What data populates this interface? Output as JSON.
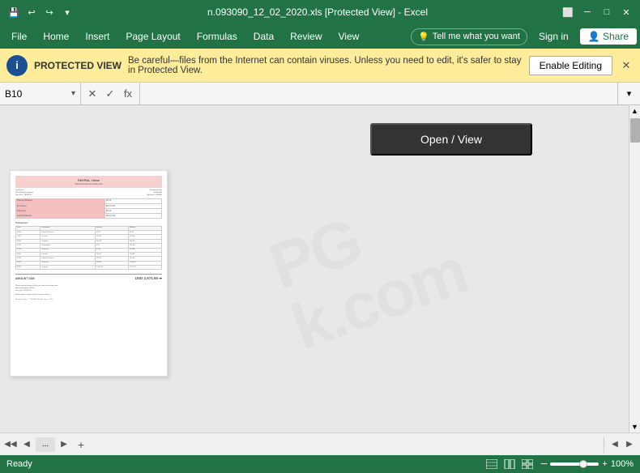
{
  "titlebar": {
    "filename": "n.093090_12_02_2020.xls [Protected View] - Excel",
    "save_icon": "💾",
    "undo_icon": "↩",
    "redo_icon": "↪",
    "minimize_icon": "─",
    "restore_icon": "□",
    "close_icon": "✕",
    "customize_icon": "▾"
  },
  "menubar": {
    "items": [
      "File",
      "Home",
      "Insert",
      "Page Layout",
      "Formulas",
      "Data",
      "Review",
      "View"
    ],
    "tell_me_placeholder": "Tell me what you want",
    "tell_me_icon": "💡",
    "sign_in": "Sign in",
    "share": "Share",
    "share_icon": "👤"
  },
  "protected_view": {
    "label": "PROTECTED VIEW",
    "message": "Be careful—files from the Internet can contain viruses. Unless you need to edit, it's safer to stay in Protected View.",
    "enable_editing": "Enable Editing",
    "icon": "i"
  },
  "formula_bar": {
    "cell_ref": "B10",
    "cancel_icon": "✕",
    "confirm_icon": "✓",
    "function_icon": "fx",
    "value": ""
  },
  "content": {
    "open_view_button": "Open / View",
    "watermark_line1": "PG",
    "watermark_line2": "k.com"
  },
  "tabs": {
    "prev_icon": "◀",
    "next_icon": "▶",
    "more_icon": "...",
    "add_icon": "+"
  },
  "statusbar": {
    "ready": "Ready",
    "zoom_percent": "100%",
    "minus_icon": "─",
    "plus_icon": "+"
  }
}
